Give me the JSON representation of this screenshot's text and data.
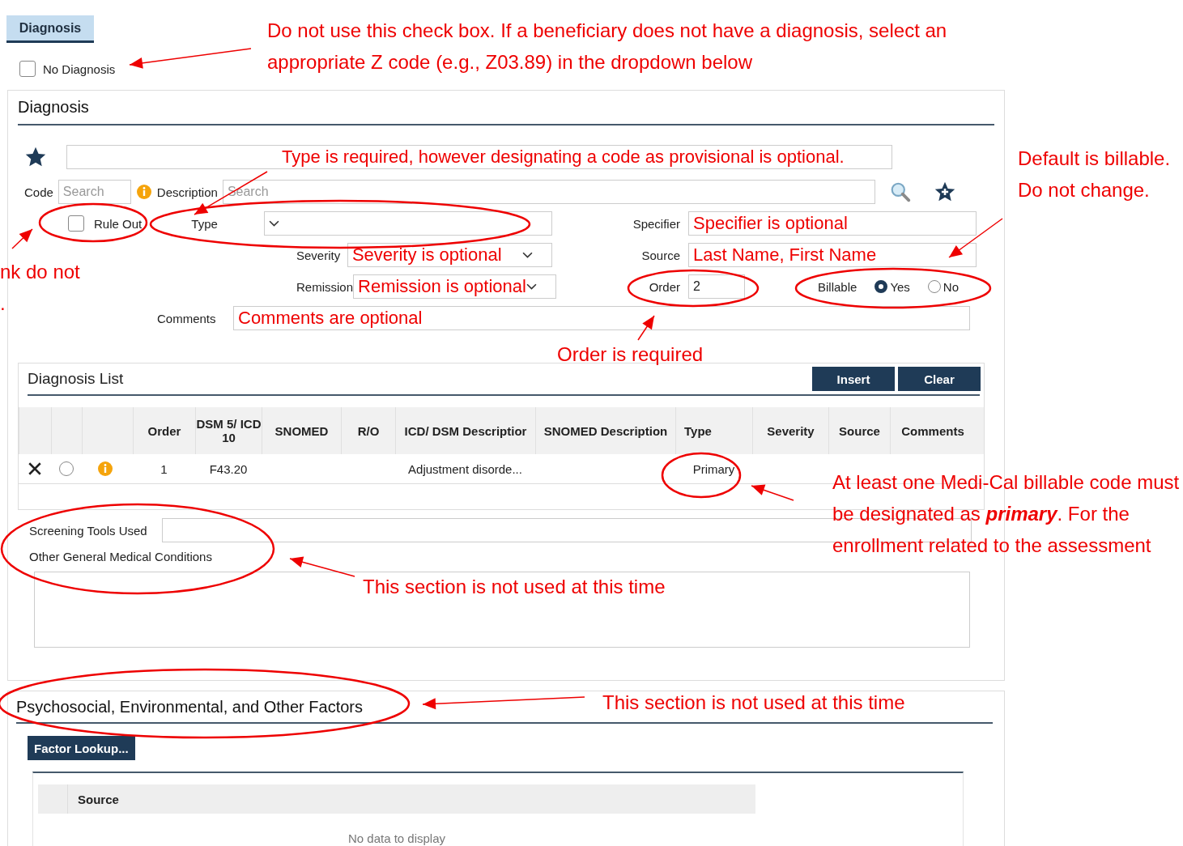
{
  "tab": {
    "label": "Diagnosis",
    "selected": true
  },
  "no_diagnosis": {
    "label": "No Diagnosis",
    "checked": false
  },
  "diagnosis": {
    "title": "Diagnosis",
    "selection": {
      "value": "Type is required, however designating a code as provisional is optional."
    },
    "code": {
      "label": "Code",
      "placeholder": "Search"
    },
    "description": {
      "label": "Description",
      "placeholder": "Search"
    },
    "rule_out": {
      "label": "Rule Out",
      "checked": false
    },
    "type": {
      "label": "Type"
    },
    "severity": {
      "label": "Severity",
      "value": "Severity is optional"
    },
    "remission": {
      "label": "Remission",
      "value": "Remission is optional"
    },
    "comments": {
      "label": "Comments",
      "value": "Comments are optional"
    },
    "specifier": {
      "label": "Specifier",
      "value": "Specifier is optional"
    },
    "source": {
      "label": "Source",
      "value": "Last Name, First Name"
    },
    "order": {
      "label": "Order",
      "value": "2"
    },
    "billable": {
      "label": "Billable",
      "options": [
        {
          "label": "Yes",
          "selected": true
        },
        {
          "label": "No",
          "selected": false
        }
      ]
    }
  },
  "diagnosis_list": {
    "title": "Diagnosis List",
    "buttons": [
      "Insert",
      "Clear"
    ],
    "columns": [
      "Order",
      "DSM 5/ ICD 10",
      "SNOMED",
      "R/O",
      "ICD/ DSM Descriptior",
      "SNOMED Description",
      "Type",
      "Severity",
      "Source",
      "Comments"
    ],
    "rows": [
      {
        "selected": false,
        "cells": [
          "1",
          "F43.20",
          "",
          "",
          "Adjustment disorde...",
          "",
          "Primary",
          "",
          "",
          ""
        ]
      }
    ]
  },
  "screening_tools": {
    "label": "Screening Tools Used"
  },
  "other_conditions": {
    "label": "Other General Medical Conditions"
  },
  "psychosocial": {
    "title": "Psychosocial, Environmental, and Other Factors",
    "button": "Factor Lookup...",
    "columns": [
      "Source"
    ],
    "empty_text": "No data to display"
  },
  "annotations": [
    "Do not use this check box. If a beneficiary does not have a diagnosis, select an appropriate Z code (e.g., Z03.89) in the dropdown below",
    "Default is billable. Do not change.",
    "nk do not",
    ".",
    "Order is required",
    "At least one Medi-Cal billable code must be designated as **primary**. For the enrollment related to the assessment",
    "This section is not used at this time",
    "This section is not used at this time"
  ]
}
